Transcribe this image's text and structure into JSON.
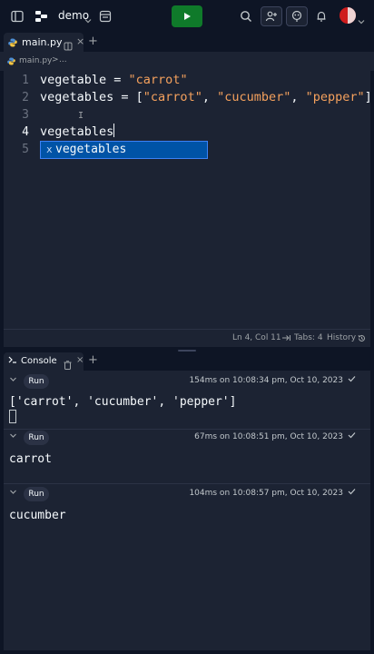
{
  "topbar": {
    "repl_name": "demo",
    "avatar_color": "#cf1d1d",
    "run_color": "#0f7a2a"
  },
  "editor_tab": {
    "label": "main.py",
    "close": "×",
    "add": "+"
  },
  "breadcrumb": {
    "file": "main.py",
    "sep": ">",
    "more": "..."
  },
  "editor": {
    "line_numbers": [
      "1",
      "2",
      "3",
      "4",
      "5"
    ],
    "active_line": "4",
    "line1": {
      "ident": "vegetable = ",
      "str": "\"carrot\""
    },
    "line2": {
      "ident": "vegetables = [",
      "s1": "\"carrot\"",
      "c1": ", ",
      "s2": "\"cucumber\"",
      "c2": ", ",
      "s3": "\"pepper\"",
      "end": "]"
    },
    "line4": "vegetables",
    "autocomplete": {
      "kind": "x",
      "text": "vegetables"
    }
  },
  "statusbar": {
    "position": "Ln 4, Col 11",
    "tabs": "Tabs: 4",
    "history": "History"
  },
  "console_tab": {
    "label": "Console",
    "close": "×",
    "add": "+"
  },
  "console": {
    "runs": [
      {
        "run_label": "Run",
        "timing": "154ms on 10:08:34 pm, Oct 10, 2023",
        "output": "['carrot', 'cucumber', 'pepper']"
      },
      {
        "run_label": "Run",
        "timing": "67ms on 10:08:51 pm, Oct 10, 2023",
        "output": "carrot"
      },
      {
        "run_label": "Run",
        "timing": "104ms on 10:08:57 pm, Oct 10, 2023",
        "output": "cucumber"
      }
    ]
  }
}
